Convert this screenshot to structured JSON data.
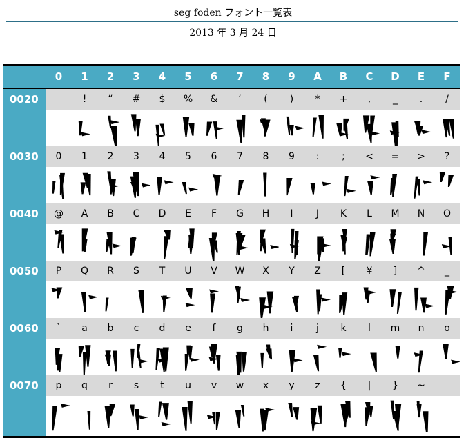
{
  "title": "seg foden フォント一覧表",
  "date": "2013 年 3 月 24 日",
  "columns": [
    "0",
    "1",
    "2",
    "3",
    "4",
    "5",
    "6",
    "7",
    "8",
    "9",
    "A",
    "B",
    "C",
    "D",
    "E",
    "F"
  ],
  "rows": [
    {
      "label": "0020",
      "chars": [
        "",
        "!",
        "“",
        "#",
        "$",
        "%",
        "&",
        "‘",
        "(",
        ")",
        "*",
        "+",
        ",",
        "_",
        ".",
        "/"
      ]
    },
    {
      "label": "0030",
      "chars": [
        "0",
        "1",
        "2",
        "3",
        "4",
        "5",
        "6",
        "7",
        "8",
        "9",
        ":",
        ";",
        "<",
        "=",
        ">",
        "?"
      ]
    },
    {
      "label": "0040",
      "chars": [
        "@",
        "A",
        "B",
        "C",
        "D",
        "E",
        "F",
        "G",
        "H",
        "I",
        "J",
        "K",
        "L",
        "M",
        "N",
        "O"
      ]
    },
    {
      "label": "0050",
      "chars": [
        "P",
        "Q",
        "R",
        "S",
        "T",
        "U",
        "V",
        "W",
        "X",
        "Y",
        "Z",
        "[",
        "¥",
        "]",
        "^",
        "_"
      ]
    },
    {
      "label": "0060",
      "chars": [
        "`",
        "a",
        "b",
        "c",
        "d",
        "e",
        "f",
        "g",
        "h",
        "i",
        "j",
        "k",
        "l",
        "m",
        "n",
        "o"
      ]
    },
    {
      "label": "0070",
      "chars": [
        "p",
        "q",
        "r",
        "s",
        "t",
        "u",
        "v",
        "w",
        "x",
        "y",
        "z",
        "{",
        "|",
        "}",
        "~",
        ""
      ]
    }
  ],
  "colors": {
    "header_bg": "#4aaac4",
    "band_bg": "#d9d9d9",
    "rule": "#2d6f88"
  }
}
